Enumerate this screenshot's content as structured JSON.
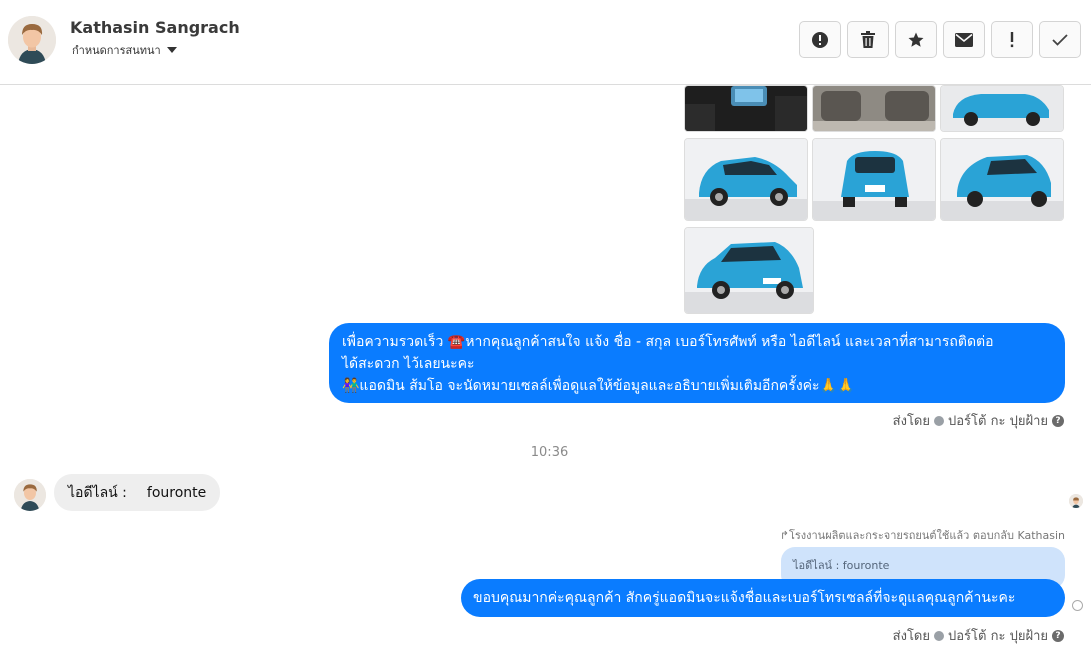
{
  "header": {
    "contact_name": "Kathasin Sangrach",
    "assign_label": "กำหนดการสนทนา",
    "toolbar": [
      {
        "name": "alert-circle-icon",
        "label": "Report"
      },
      {
        "name": "trash-icon",
        "label": "Delete"
      },
      {
        "name": "star-icon",
        "label": "Star"
      },
      {
        "name": "envelope-icon",
        "label": "Mark unread"
      },
      {
        "name": "exclamation-icon",
        "label": "Important"
      },
      {
        "name": "checkmark-icon",
        "label": "Done"
      }
    ]
  },
  "messages": {
    "outgoing_1": {
      "line1": "เพื่อความรวดเร็ว  ☎️หากคุณลูกค้าสนใจ แจ้ง ชื่อ - สกุล เบอร์โทรศัพท์ หรือ ไอดีไลน์ และเวลาที่สามารถติดต่อ",
      "line2": "ได้สะดวก ไว้เลยนะคะ",
      "line3": "👫แอดมิน ส้มโอ จะนัดหมายเซลล์เพื่อดูแลให้ข้อมูลและอธิบายเพิ่มเติมอีกครั้งค่ะ🙏🙏",
      "sent_by": "ส่งโดย",
      "sender": "ปอร์โต้ กะ ปุยฝ้าย"
    },
    "timestamp": "10:36",
    "incoming_1": {
      "label": "ไอดีไลน์ :",
      "value": "fouronte"
    },
    "reply_note": "↱โรงงานผลิตและกระจายรถยนต์ใช้แล้ว ตอบกลับ Kathasin",
    "quoted_text": "ไอดีไลน์ : fouronte",
    "outgoing_2": {
      "text": "ขอบคุณมากค่ะคุณลูกค้า สักครู่แอดมินจะแจ้งชื่อและเบอร์โทรเซลล์ที่จะดูแลคุณลูกค้านะคะ",
      "sent_by": "ส่งโดย",
      "sender": "ปอร์โต้ กะ ปุยฝ้าย"
    }
  },
  "colors": {
    "outgoing_bubble": "#0a7cff",
    "incoming_bubble": "#eeeeee",
    "quote_bubble": "#cfe3fb",
    "car_body": "#2aa3d6"
  }
}
